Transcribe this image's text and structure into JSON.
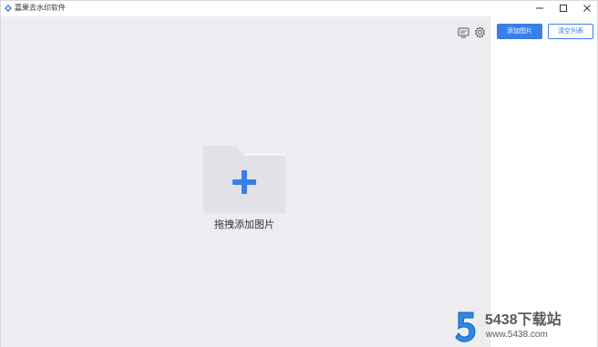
{
  "window": {
    "title": "嘉果去水印软件",
    "min_glyph": "—",
    "max_glyph": "☐",
    "close_glyph": "✕"
  },
  "toolbar": {
    "message_icon": "message-icon",
    "settings_icon": "gear-icon"
  },
  "drop_area": {
    "label": "拖拽添加图片",
    "icon": "folder-add-icon"
  },
  "right_panel": {
    "add_button_label": "添加图片",
    "clear_button_label": "清空列表"
  },
  "watermark": {
    "logo_text": "5",
    "title": "5438下载站",
    "url": "www.5438.com"
  },
  "colors": {
    "accent": "#3a7ee8",
    "drop_background": "#ecedf1",
    "folder": "#e1e2e7"
  }
}
